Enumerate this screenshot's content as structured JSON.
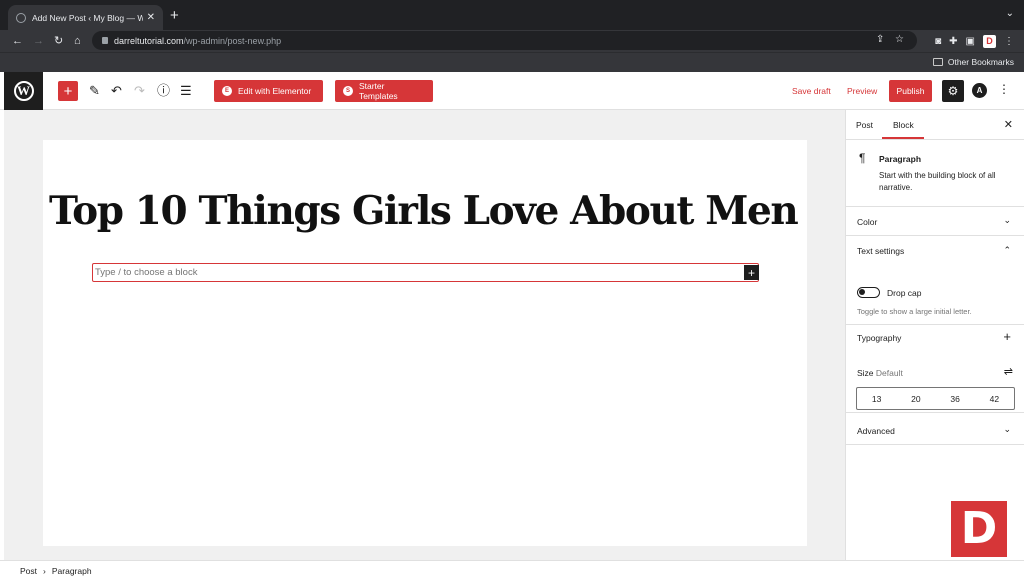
{
  "browser": {
    "tab_title": "Add New Post ‹ My Blog — Wo…",
    "url_host": "darreltutorial.com",
    "url_path": "/wp-admin/post-new.php",
    "bookmarks_label": "Other Bookmarks",
    "ext_d": "D"
  },
  "toolbar": {
    "elementor_label": "Edit with Elementor",
    "starter_label": "Starter Templates",
    "save_draft_label": "Save draft",
    "preview_label": "Preview",
    "publish_label": "Publish"
  },
  "editor": {
    "post_title": "Top 10 Things Girls Love About Men",
    "block_placeholder": "Type / to choose a block"
  },
  "sidebar": {
    "tabs": [
      {
        "label": "Post",
        "active": false
      },
      {
        "label": "Block",
        "active": true
      }
    ],
    "block": {
      "title": "Paragraph",
      "description": "Start with the building block of all narrative."
    },
    "color_label": "Color",
    "text_settings": {
      "label": "Text settings",
      "drop_cap_label": "Drop cap",
      "drop_cap_on": false,
      "help": "Toggle to show a large initial letter."
    },
    "typography": {
      "label": "Typography",
      "size_label": "Size",
      "size_value": "Default",
      "sizes": [
        "13",
        "20",
        "36",
        "42"
      ]
    },
    "advanced_label": "Advanced"
  },
  "breadcrumb": {
    "root": "Post",
    "current": "Paragraph"
  },
  "brand": {
    "accent": "#d63638",
    "dark": "#1e1e1e",
    "logo_letter": "D"
  }
}
